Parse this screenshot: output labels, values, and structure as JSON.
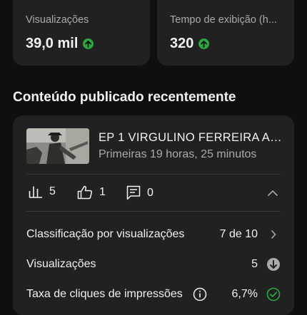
{
  "stats": [
    {
      "label": "Visualizações",
      "value": "39,0 mil",
      "trend": "up"
    },
    {
      "label": "Tempo de exibição (h...",
      "value": "320",
      "trend": "up"
    }
  ],
  "section": {
    "title": "Conteúdo publicado recentemente"
  },
  "video": {
    "title": "EP 1 VIRGULINO FERREIRA APÊ...",
    "meta": "Primeiras 19 horas, 25 minutos",
    "views_count": "5",
    "likes_count": "1",
    "comments_count": "0"
  },
  "metrics": [
    {
      "label": "Classificação por visualizações",
      "value": "7 de 10",
      "icon": "chevron-right-icon"
    },
    {
      "label": "Visualizações",
      "value": "5",
      "icon": "down-arrow-circle-icon"
    },
    {
      "label": "Taxa de cliques de impressões",
      "value": "6,7%",
      "icon": "check-circle-icon"
    }
  ],
  "colors": {
    "background": "#0f0f0f",
    "card": "#212121",
    "positive": "#2ba640",
    "secondary_text": "#aaaaaa"
  }
}
